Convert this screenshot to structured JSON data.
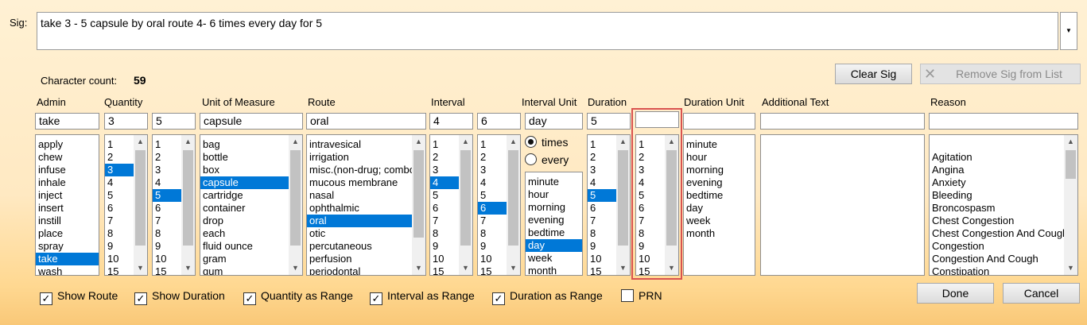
{
  "sig": {
    "label": "Sig:",
    "value": "take 3 - 5 capsule by oral route 4- 6 times every day for 5",
    "dropdown_glyph": "▼"
  },
  "character_count": {
    "label": "Character count:",
    "value": "59"
  },
  "buttons": {
    "clear_sig": "Clear Sig",
    "remove_sig": "Remove Sig from List",
    "done": "Done",
    "cancel": "Cancel"
  },
  "headers": {
    "admin": "Admin",
    "quantity": "Quantity",
    "unit": "Unit of Measure",
    "route": "Route",
    "interval": "Interval",
    "interval_unit": "Interval Unit",
    "duration": "Duration",
    "duration_unit": "Duration Unit",
    "additional_text": "Additional Text",
    "reason": "Reason"
  },
  "fields": {
    "admin": "take",
    "quantity_from": "3",
    "quantity_to": "5",
    "unit": "capsule",
    "route": "oral",
    "interval_from": "4",
    "interval_to": "6",
    "interval_unit": "day",
    "duration_from": "5",
    "duration_to": "",
    "duration_unit": "",
    "additional_text": "",
    "reason": ""
  },
  "lists": {
    "admin": {
      "items": [
        "apply",
        "chew",
        "infuse",
        "inhale",
        "inject",
        "insert",
        "instill",
        "place",
        "spray",
        "take",
        "wash"
      ],
      "selected": 9
    },
    "quantity_from": {
      "items": [
        "1",
        "2",
        "3",
        "4",
        "5",
        "6",
        "7",
        "8",
        "9",
        "10",
        "15"
      ],
      "selected": 2
    },
    "quantity_to": {
      "items": [
        "1",
        "2",
        "3",
        "4",
        "5",
        "6",
        "7",
        "8",
        "9",
        "10",
        "15"
      ],
      "selected": 4
    },
    "unit": {
      "items": [
        "bag",
        "bottle",
        "box",
        "capsule",
        "cartridge",
        "container",
        "drop",
        "each",
        "fluid ounce",
        "gram",
        "gum"
      ],
      "selected": 3
    },
    "route": {
      "items": [
        "intravesical",
        "irrigation",
        "misc.(non-drug; combo route)",
        "mucous membrane",
        "nasal",
        "ophthalmic",
        "oral",
        "otic",
        "percutaneous",
        "perfusion",
        "periodontal"
      ],
      "selected": 6
    },
    "interval_from": {
      "items": [
        "1",
        "2",
        "3",
        "4",
        "5",
        "6",
        "7",
        "8",
        "9",
        "10",
        "15"
      ],
      "selected": 3
    },
    "interval_to": {
      "items": [
        "1",
        "2",
        "3",
        "4",
        "5",
        "6",
        "7",
        "8",
        "9",
        "10",
        "15"
      ],
      "selected": 5
    },
    "interval_unit": {
      "items": [
        "minute",
        "hour",
        "morning",
        "evening",
        "bedtime",
        "day",
        "week",
        "month"
      ],
      "selected": 5
    },
    "duration_from": {
      "items": [
        "1",
        "2",
        "3",
        "4",
        "5",
        "6",
        "7",
        "8",
        "9",
        "10",
        "15"
      ],
      "selected": 4
    },
    "duration_to": {
      "items": [
        "1",
        "2",
        "3",
        "4",
        "5",
        "6",
        "7",
        "8",
        "9",
        "10",
        "15"
      ],
      "selected": -1
    },
    "duration_unit": {
      "items": [
        "minute",
        "hour",
        "morning",
        "evening",
        "bedtime",
        "day",
        "week",
        "month"
      ],
      "selected": -1
    },
    "reason": {
      "items": [
        "Agitation",
        "Angina",
        "Anxiety",
        "Bleeding",
        "Broncospasm",
        "Chest Congestion",
        "Chest Congestion And Cough",
        "Congestion",
        "Congestion And Cough",
        "Constipation"
      ],
      "selected": -1
    }
  },
  "radios": {
    "times": "times",
    "every": "every",
    "selected": "times"
  },
  "checkboxes": {
    "show_route": {
      "label": "Show Route",
      "checked": true
    },
    "show_duration": {
      "label": "Show Duration",
      "checked": true
    },
    "quantity_range": {
      "label": "Quantity as Range",
      "checked": true
    },
    "interval_range": {
      "label": "Interval as Range",
      "checked": true
    },
    "duration_range": {
      "label": "Duration as Range",
      "checked": true
    },
    "prn": {
      "label": "PRN",
      "checked": false
    }
  },
  "icons": {
    "remove": "x-icon",
    "scroll_up": "chevron-up-icon",
    "scroll_down": "chevron-down-icon",
    "check": "✓"
  },
  "colors": {
    "selection": "#0078d7",
    "highlight": "#d9534f"
  }
}
